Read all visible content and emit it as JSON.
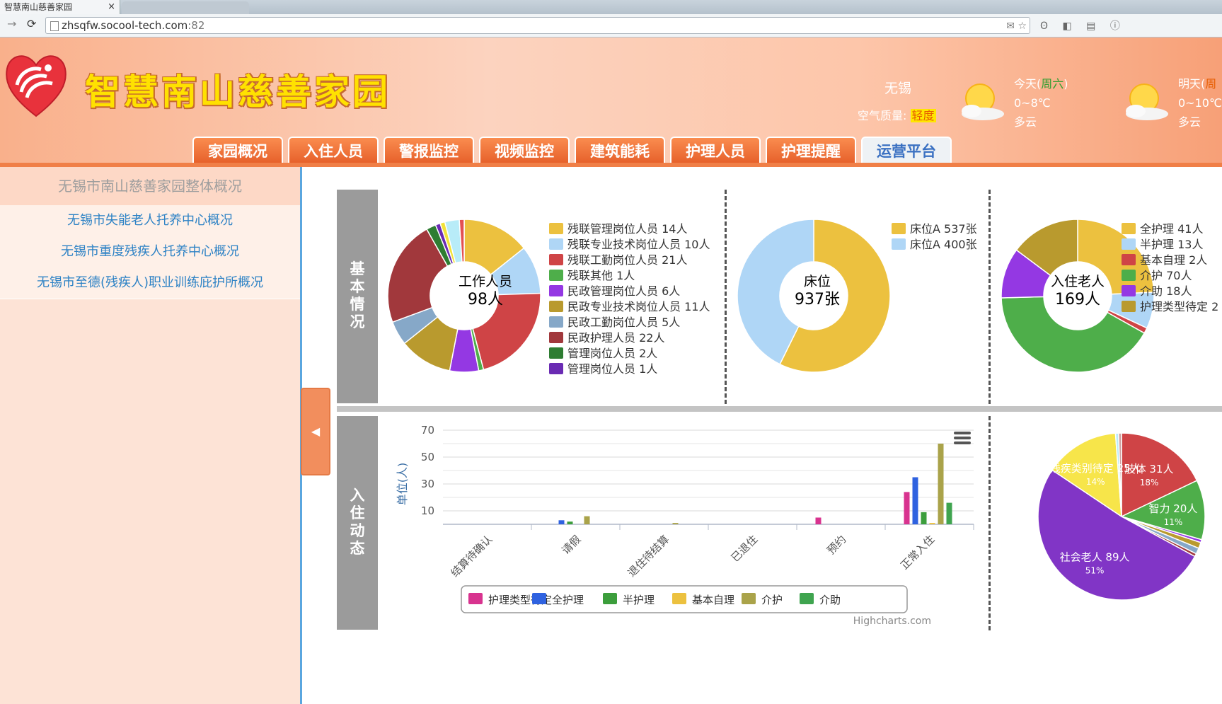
{
  "browser": {
    "tab_title": "智慧南山慈善家园",
    "tab_close": "×",
    "url_host": "zhsqfw.socool-tech.com",
    "url_port": ":82",
    "omni_icons": "✉ ☆",
    "ext_icons": "ʘ ◧ ▤ ⓘ"
  },
  "header": {
    "site_title": "智慧南山慈善家园",
    "weather": {
      "city": "无锡",
      "air_quality_label": "空气质量:",
      "air_quality_value": "轻度",
      "today": {
        "day": "今天(",
        "weekday": "周六",
        "close": ")",
        "temp": "0~8℃",
        "desc": "多云"
      },
      "tomorrow": {
        "day": "明天(",
        "weekday": "周",
        "temp": "0~10℃",
        "desc": "多云"
      }
    }
  },
  "nav": {
    "tabs": [
      {
        "label": "家园概况",
        "active": false
      },
      {
        "label": "入住人员",
        "active": false
      },
      {
        "label": "警报监控",
        "active": false
      },
      {
        "label": "视频监控",
        "active": false
      },
      {
        "label": "建筑能耗",
        "active": false
      },
      {
        "label": "护理人员",
        "active": false
      },
      {
        "label": "护理提醒",
        "active": false
      },
      {
        "label": "运营平台",
        "active": true
      }
    ]
  },
  "sidebar": {
    "title": "无锡市南山慈善家园整体概况",
    "items": [
      {
        "label": "无锡市失能老人托养中心概况"
      },
      {
        "label": "无锡市重度残疾人托养中心概况"
      },
      {
        "label": "无锡市至德(残疾人)职业训练庇护所概况"
      }
    ],
    "collapse_glyph": "◀"
  },
  "sections": {
    "basic": [
      "基",
      "本",
      "情",
      "况"
    ],
    "dynamic": [
      "入",
      "住",
      "动",
      "态"
    ]
  },
  "chart_data": [
    {
      "type": "pie",
      "donut": true,
      "center_label": "工作人员",
      "center_value": "98人",
      "series": [
        {
          "name": "残联管理岗位人员",
          "value": 14,
          "label": "14人",
          "color": "#ecc13f"
        },
        {
          "name": "残联专业技术岗位人员",
          "value": 10,
          "label": "10人",
          "color": "#afd6f6"
        },
        {
          "name": "残联工勤岗位人员",
          "value": 21,
          "label": "21人",
          "color": "#cf4446"
        },
        {
          "name": "残联其他",
          "value": 1,
          "label": "1人",
          "color": "#4eae4a"
        },
        {
          "name": "民政管理岗位人员",
          "value": 6,
          "label": "6人",
          "color": "#9438e3"
        },
        {
          "name": "民政专业技术岗位人员",
          "value": 11,
          "label": "11人",
          "color": "#b99a2e"
        },
        {
          "name": "民政工勤岗位人员",
          "value": 5,
          "label": "5人",
          "color": "#86a8c8"
        },
        {
          "name": "民政护理人员",
          "value": 22,
          "label": "22人",
          "color": "#a1383c"
        },
        {
          "name": "管理岗位人员",
          "value": 2,
          "label": "2人",
          "color": "#2e7d32"
        },
        {
          "name": "管理岗位人员",
          "value": 1,
          "label": "1人",
          "color": "#6a2bb3"
        },
        {
          "value": 1,
          "color": "#f2e23a"
        },
        {
          "value": 3,
          "color": "#b8ecf8"
        },
        {
          "value": 1,
          "color": "#e35050"
        }
      ]
    },
    {
      "type": "pie",
      "donut": true,
      "center_label": "床位",
      "center_value": "937张",
      "series": [
        {
          "name": "床位A",
          "value": 537,
          "label": "537张",
          "color": "#ecc13f"
        },
        {
          "name": "床位A",
          "value": 400,
          "label": "400张",
          "color": "#afd6f6"
        }
      ]
    },
    {
      "type": "pie",
      "donut": true,
      "center_label": "入住老人",
      "center_value": "169人",
      "series": [
        {
          "name": "全护理",
          "value": 41,
          "label": "41人",
          "color": "#ecc13f"
        },
        {
          "name": "半护理",
          "value": 13,
          "label": "13人",
          "color": "#afd6f6"
        },
        {
          "name": "基本自理",
          "value": 2,
          "label": "2人",
          "color": "#cf4446"
        },
        {
          "name": "介护",
          "value": 70,
          "label": "70人",
          "color": "#4eae4a"
        },
        {
          "name": "介助",
          "value": 18,
          "label": "18人",
          "color": "#9438e3"
        },
        {
          "name": "护理类型待定",
          "value": 25,
          "label": "2",
          "color": "#b99a2e"
        }
      ]
    },
    {
      "type": "bar",
      "ylabel": "单位(人)",
      "yticks": [
        10,
        30,
        50,
        70
      ],
      "ylim": [
        0,
        70
      ],
      "categories": [
        "结算待确认",
        "请假",
        "退住待结算",
        "已退住",
        "预约",
        "正常入住"
      ],
      "series": [
        {
          "name": "护理类型待定",
          "color": "#d8338f",
          "values": [
            0,
            0,
            0,
            0,
            5,
            24
          ]
        },
        {
          "name": "全护理",
          "color": "#2f62e0",
          "values": [
            0,
            3,
            0,
            0,
            0,
            35
          ]
        },
        {
          "name": "半护理",
          "color": "#3c9e3c",
          "values": [
            0,
            2,
            0,
            0,
            0,
            9
          ]
        },
        {
          "name": "基本自理",
          "color": "#ecc13f",
          "values": [
            0,
            0,
            0,
            0,
            0,
            1
          ]
        },
        {
          "name": "介护",
          "color": "#aaa34a",
          "values": [
            0,
            6,
            1,
            0,
            0,
            60
          ]
        },
        {
          "name": "介助",
          "color": "#3fa44f",
          "values": [
            0,
            0,
            0,
            0,
            0,
            16
          ]
        }
      ],
      "menu_icon": "hamburger-icon",
      "credit": "Highcharts.com"
    },
    {
      "type": "pie",
      "series": [
        {
          "name": "肢体",
          "value": 31,
          "label": "肢体 31人",
          "pct": "18%",
          "color": "#cf4446"
        },
        {
          "name": "智力",
          "value": 20,
          "label": "智力 20人",
          "pct": "11%",
          "color": "#4eae4a"
        },
        {
          "value": 1,
          "color": "#9438e3"
        },
        {
          "value": 2,
          "color": "#b99a2e"
        },
        {
          "value": 2,
          "color": "#86a8c8"
        },
        {
          "value": 1,
          "color": "#a1383c"
        },
        {
          "name": "社会老人",
          "value": 89,
          "label": "社会老人 89人",
          "pct": "51%",
          "color": "#8135c6"
        },
        {
          "name": "残疾类别待定",
          "value": 25,
          "label": "残疾类别待定 25人",
          "pct": "14%",
          "color": "#f7e54a"
        },
        {
          "value": 1,
          "color": "#b8ecf8"
        },
        {
          "value": 1,
          "color": "#cfa0a0"
        }
      ]
    }
  ]
}
